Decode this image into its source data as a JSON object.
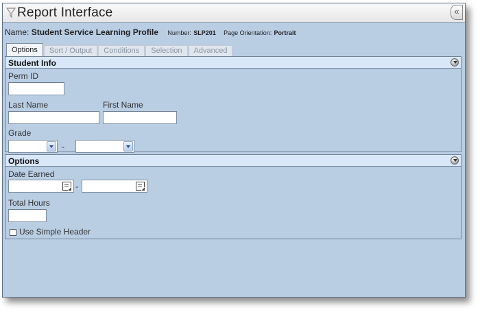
{
  "window": {
    "title": "Report Interface",
    "collapse_glyph": "«"
  },
  "report": {
    "name_label": "Name:",
    "name_value": "Student Service Learning Profile",
    "number_label": "Number:",
    "number_value": "SLP201",
    "orientation_label": "Page Orientation:",
    "orientation_value": "Portrait"
  },
  "tabs": [
    {
      "label": "Options",
      "active": true
    },
    {
      "label": "Sort / Output",
      "active": false
    },
    {
      "label": "Conditions",
      "active": false
    },
    {
      "label": "Selection",
      "active": false
    },
    {
      "label": "Advanced",
      "active": false
    }
  ],
  "student_info": {
    "title": "Student Info",
    "perm_id_label": "Perm ID",
    "perm_id_value": "",
    "last_name_label": "Last Name",
    "last_name_value": "",
    "first_name_label": "First Name",
    "first_name_value": "",
    "grade_label": "Grade",
    "grade_from": "",
    "grade_to": "",
    "range_dash": "-"
  },
  "options": {
    "title": "Options",
    "date_earned_label": "Date Earned",
    "date_from": "",
    "date_to": "",
    "range_dash": "-",
    "total_hours_label": "Total Hours",
    "total_hours_value": "",
    "simple_header_label": "Use Simple Header",
    "simple_header_checked": false
  },
  "icons": {
    "title": "funnel-icon",
    "panel_toggle": "collapse-circle-icon",
    "date_picker": "calendar-icon",
    "select_arrow": "chevron-down-icon"
  },
  "colors": {
    "background": "#b9cde3",
    "panel_header": "#d9e8f8",
    "border": "#6f8297"
  }
}
